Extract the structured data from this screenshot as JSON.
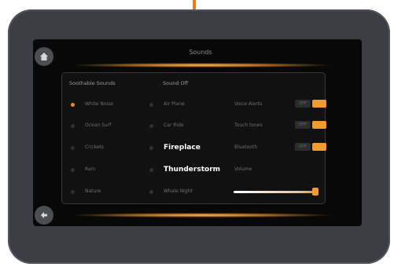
{
  "title": "Sounds",
  "sections": {
    "soothable_sounds": "Soothable Sounds",
    "sound_off": "Sound Off"
  },
  "column1": [
    {
      "label": "White Noise",
      "active": true
    },
    {
      "label": "Ocean Surf",
      "active": false
    },
    {
      "label": "Crickets",
      "active": false
    },
    {
      "label": "Rain",
      "active": false
    },
    {
      "label": "Nature",
      "active": false
    }
  ],
  "column2": [
    {
      "label": "Air Plane",
      "active": false
    },
    {
      "label": "Car Ride",
      "active": false
    },
    {
      "label": "Fireplace",
      "active": false
    },
    {
      "label": "Thunderstorm",
      "active": false
    },
    {
      "label": "Whale Night",
      "active": false
    }
  ],
  "settings": {
    "voice_alerts": "Voice Alerts",
    "touch_tones": "Touch tones",
    "bluetooth": "Bluetooth",
    "volume": "Volume",
    "off_label": "OFF",
    "volume_level": 0.95
  },
  "icons": {
    "home": "home-icon",
    "back": "back-arrow-icon"
  },
  "colors": {
    "accent": "#e98b28",
    "screen": "#080808",
    "bezel": "#3b3e44"
  }
}
